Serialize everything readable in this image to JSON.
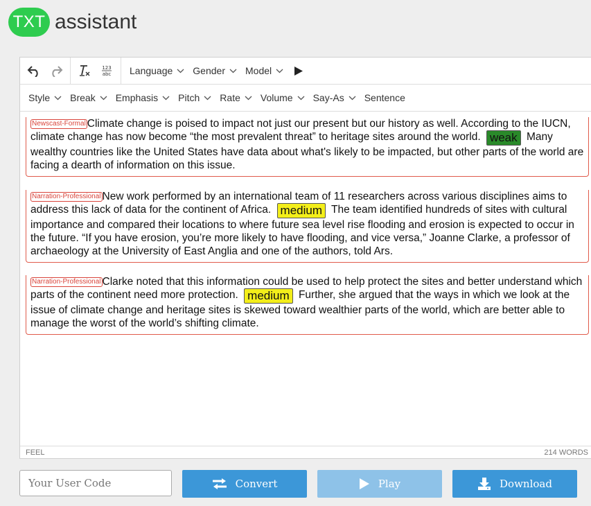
{
  "app": {
    "logo_badge": "TXT",
    "logo_text": "assistant"
  },
  "toolbar1": {
    "language": "Language",
    "gender": "Gender",
    "model": "Model"
  },
  "toolbar2": {
    "style": "Style",
    "break": "Break",
    "emphasis": "Emphasis",
    "pitch": "Pitch",
    "rate": "Rate",
    "volume": "Volume",
    "say_as": "Say-As",
    "sentence": "Sentence"
  },
  "paragraphs": [
    {
      "style": "Newscast-Formal",
      "text1": "Climate change is poised to impact not just our present but our history as well. According to the IUCN, climate change has now become “the most prevalent threat” to heritage sites around the world.",
      "break": "weak",
      "text2": "Many wealthy countries like the United States have data about what's likely to be impacted, but other parts of the world are facing a dearth of information on this issue."
    },
    {
      "style": "Narration-Professional",
      "text1": "New work performed by an international team of 11 researchers across various disciplines aims to address this lack of data for the continent of Africa.",
      "break": "medium",
      "text2": "The team identified hundreds of sites with cultural importance and compared their locations to where future sea level rise flooding and erosion is expected to occur in the future. “If you have erosion, you’re more likely to have flooding, and vice versa,” Joanne Clarke, a professor of archaeology at the University of East Anglia and one of the authors, told Ars."
    },
    {
      "style": "Narration-Professional",
      "text1": "Clarke noted that this information could be used to help protect the sites and better understand which parts of the continent need more protection.",
      "break": "medium",
      "text2": "Further, she argued that the ways in which we look at the issue of climate change and heritage sites is skewed toward wealthier parts of the world, which are better able to manage the worst of the world’s shifting climate."
    }
  ],
  "status": {
    "left": "FEEL",
    "word_count": "214 WORDS"
  },
  "bottom": {
    "user_code_placeholder": "Your User Code",
    "convert": "Convert",
    "play": "Play",
    "download": "Download"
  },
  "colors": {
    "logo_green": "#2ecc4f",
    "button_blue": "#3c97d8",
    "button_disabled": "#8ec2e8",
    "tag_red": "#d9443a",
    "weak_break": "#2a8a2a",
    "medium_break": "#f3ee1a"
  }
}
